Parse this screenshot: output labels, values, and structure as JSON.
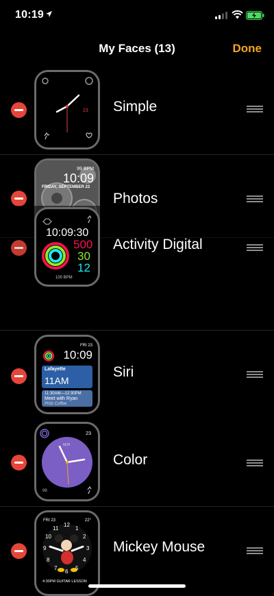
{
  "status": {
    "time": "10:19"
  },
  "nav": {
    "title": "My Faces (13)",
    "done": "Done"
  },
  "faces": [
    {
      "name": "Simple",
      "date": "23"
    },
    {
      "name": "Photos",
      "info": "99 BPM",
      "date": "FRIDAY, SEPTEMBER 23",
      "time": "10:09"
    },
    {
      "name": "Activity Digital",
      "time": "10:09:30",
      "move": "500",
      "exercise": "30",
      "stand": "12",
      "bpm": "100 BPM"
    },
    {
      "name": "Siri",
      "date": "FRI 23",
      "time": "10:09",
      "weather_loc": "Lafayette",
      "weather_time": "11AM",
      "event_time": "11:30AM—12:30PM",
      "event_title": "Meet with Ryan",
      "event_loc": "Philz Coffee"
    },
    {
      "name": "Color",
      "date": "23",
      "brand": "MJH",
      "temp": "99"
    },
    {
      "name": "Mickey Mouse",
      "date": "FRI 23",
      "temp": "22°",
      "event": "4:30PM GUITAR LESSON",
      "n12": "12",
      "n1": "1",
      "n2": "2",
      "n3": "3",
      "n4": "4",
      "n5": "5",
      "n6": "6",
      "n7": "7",
      "n8": "8",
      "n9": "9",
      "n10": "10",
      "n11": "11"
    }
  ],
  "colors": {
    "accent": "#F5A623",
    "delete": "#E5453A",
    "color_face": "#7B5FC4"
  }
}
